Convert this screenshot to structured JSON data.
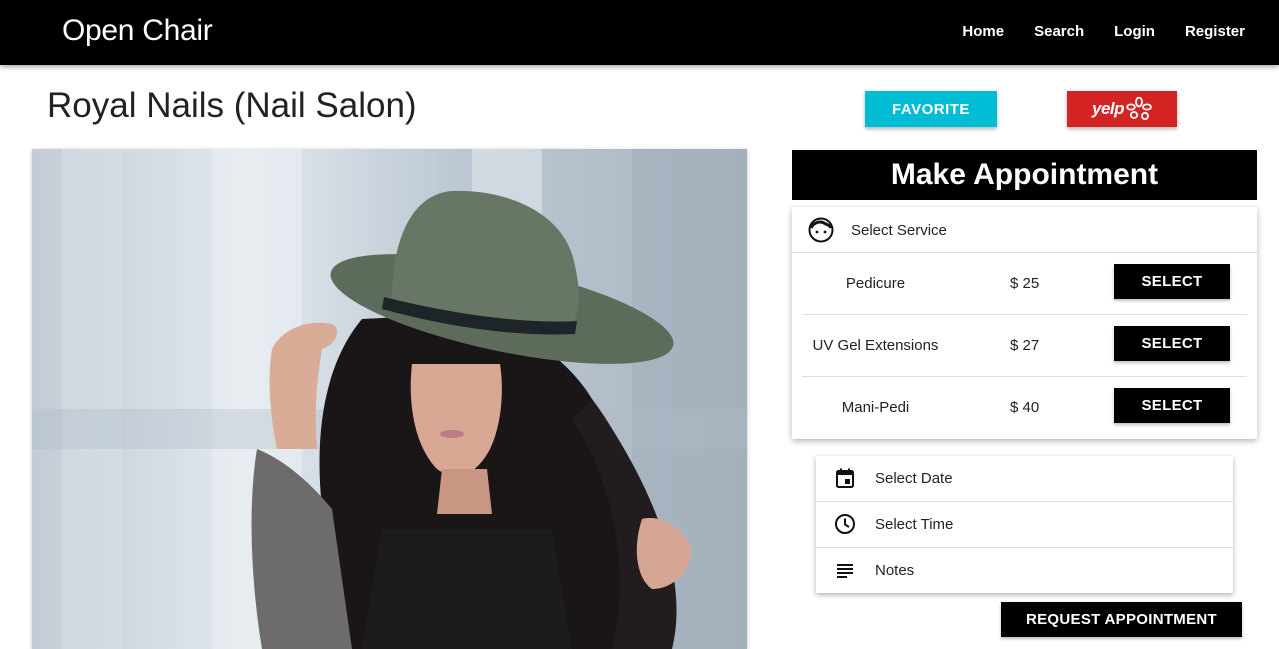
{
  "navbar": {
    "brand": "Open Chair",
    "links": [
      "Home",
      "Search",
      "Login",
      "Register"
    ]
  },
  "salon": {
    "title": "Royal Nails (Nail Salon)",
    "favorite_label": "FAVORITE",
    "yelp_label": "yelp"
  },
  "appointment": {
    "header": "Make Appointment",
    "service_header": "Select Service",
    "services": [
      {
        "name": "Pedicure",
        "price": "$ 25",
        "button": "SELECT"
      },
      {
        "name": "UV Gel Extensions",
        "price": "$ 27",
        "button": "SELECT"
      },
      {
        "name": "Mani-Pedi",
        "price": "$ 40",
        "button": "SELECT"
      }
    ],
    "date_label": "Select Date",
    "time_label": "Select Time",
    "notes_label": "Notes",
    "request_button": "REQUEST APPOINTMENT"
  },
  "colors": {
    "navbar": "#000000",
    "favorite": "#00bcd4",
    "yelp": "#d32323",
    "buttons": "#000000"
  },
  "icons": [
    "face-icon",
    "calendar-icon",
    "clock-icon",
    "notes-icon",
    "yelp-burst-icon"
  ]
}
